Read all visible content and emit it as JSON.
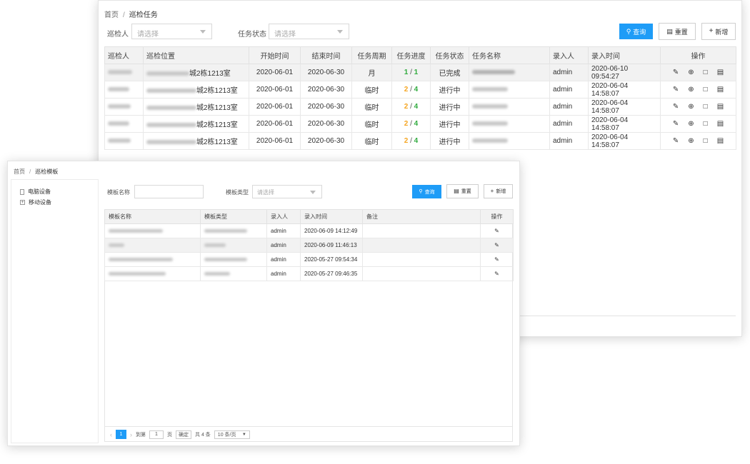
{
  "task_window": {
    "breadcrumb": {
      "home": "首页",
      "current": "巡检任务"
    },
    "filters": {
      "inspector_label": "巡检人",
      "inspector_placeholder": "请选择",
      "status_label": "任务状态",
      "status_placeholder": "请选择"
    },
    "buttons": {
      "query": "查询",
      "reset": "重置",
      "add": "新增"
    },
    "columns": [
      "巡检人",
      "巡检位置",
      "开始时间",
      "结束时间",
      "任务周期",
      "任务进度",
      "任务状态",
      "任务名称",
      "录入人",
      "录入时间",
      "操作"
    ],
    "rows": [
      {
        "location_suffix": "城2栋1213室",
        "start": "2020-06-01",
        "end": "2020-06-30",
        "cycle": "月",
        "progress_done": "1",
        "progress_total": "1",
        "status": "已完成",
        "creator": "admin",
        "created": "2020-06-10 09:54:27"
      },
      {
        "location_suffix": "城2栋1213室",
        "start": "2020-06-01",
        "end": "2020-06-30",
        "cycle": "临时",
        "progress_done": "2",
        "progress_total": "4",
        "status": "进行中",
        "creator": "admin",
        "created": "2020-06-04 14:58:07"
      },
      {
        "location_suffix": "城2栋1213室",
        "start": "2020-06-01",
        "end": "2020-06-30",
        "cycle": "临时",
        "progress_done": "2",
        "progress_total": "4",
        "status": "进行中",
        "creator": "admin",
        "created": "2020-06-04 14:58:07"
      },
      {
        "location_suffix": "城2栋1213室",
        "start": "2020-06-01",
        "end": "2020-06-30",
        "cycle": "临时",
        "progress_done": "2",
        "progress_total": "4",
        "status": "进行中",
        "creator": "admin",
        "created": "2020-06-04 14:58:07"
      },
      {
        "location_suffix": "城2栋1213室",
        "start": "2020-06-01",
        "end": "2020-06-30",
        "cycle": "临时",
        "progress_done": "2",
        "progress_total": "4",
        "status": "进行中",
        "creator": "admin",
        "created": "2020-06-04 14:58:07"
      }
    ],
    "progress_separator": "/"
  },
  "template_window": {
    "breadcrumb": {
      "home": "首页",
      "current": "巡检模板"
    },
    "tree": [
      {
        "label": "电脑设备",
        "icon": "document-icon"
      },
      {
        "label": "移动设备",
        "icon": "expand-plus-icon"
      }
    ],
    "filters": {
      "name_label": "模板名称",
      "type_label": "模板类型",
      "type_placeholder": "请选择"
    },
    "buttons": {
      "query": "查询",
      "reset": "重置",
      "add": "新增"
    },
    "columns": [
      "模板名称",
      "模板类型",
      "录入人",
      "录入时间",
      "备注",
      "操作"
    ],
    "rows": [
      {
        "creator": "admin",
        "created": "2020-06-09 14:12:49"
      },
      {
        "creator": "admin",
        "created": "2020-06-09 11:46:13"
      },
      {
        "creator": "admin",
        "created": "2020-05-27 09:54:34"
      },
      {
        "creator": "admin",
        "created": "2020-05-27 09:46:35"
      }
    ],
    "pagination": {
      "current_page": "1",
      "goto_label": "到第",
      "goto_value": "1",
      "page_unit": "页",
      "confirm": "确定",
      "total": "共 4 条",
      "page_size": "10 条/页"
    }
  },
  "colors": {
    "primary": "#1e9cf7",
    "progress_in_progress": "#f5a623",
    "progress_done": "#2faa3d"
  }
}
